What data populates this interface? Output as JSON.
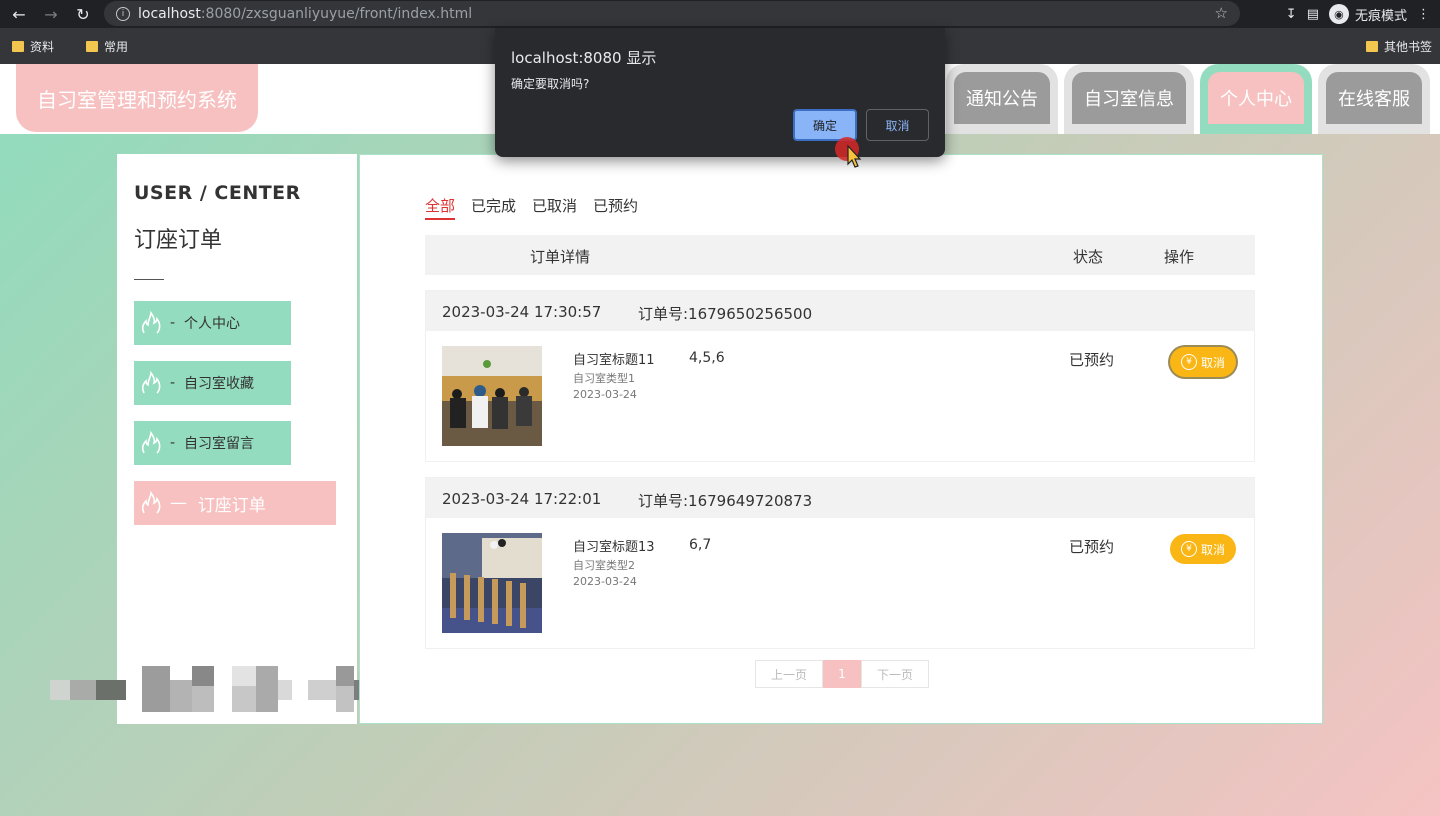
{
  "browser": {
    "url_host": "localhost",
    "url_port_path": ":8080/zxsguanliyuyue/front/index.html",
    "incognito_label": "无痕模式",
    "bookmarks": [
      "资料",
      "常用"
    ],
    "other_bookmarks": "其他书签"
  },
  "site": {
    "logo": "自习室管理和预约系统",
    "nav": [
      {
        "label": "通知公告",
        "active": false
      },
      {
        "label": "自习室信息",
        "active": false
      },
      {
        "label": "个人中心",
        "active": true
      },
      {
        "label": "在线客服",
        "active": false
      }
    ]
  },
  "sidebar": {
    "title": "USER / CENTER",
    "subtitle": "订座订单",
    "items": [
      {
        "prefix": "-",
        "label": "个人中心"
      },
      {
        "prefix": "-",
        "label": "自习室收藏"
      },
      {
        "prefix": "-",
        "label": "自习室留言"
      },
      {
        "prefix": "—",
        "label": "订座订单"
      }
    ]
  },
  "orders": {
    "filters": [
      "全部",
      "已完成",
      "已取消",
      "已预约"
    ],
    "headers": {
      "detail": "订单详情",
      "status": "状态",
      "action": "操作"
    },
    "items": [
      {
        "time": "2023-03-24 17:30:57",
        "order_no": "订单号:1679650256500",
        "title": "自习室标题11",
        "type": "自习室类型1",
        "date": "2023-03-24",
        "seats": "4,5,6",
        "status": "已预约",
        "action": "取消"
      },
      {
        "time": "2023-03-24 17:22:01",
        "order_no": "订单号:1679649720873",
        "title": "自习室标题13",
        "type": "自习室类型2",
        "date": "2023-03-24",
        "seats": "6,7",
        "status": "已预约",
        "action": "取消"
      }
    ],
    "pager": {
      "prev": "上一页",
      "page": "1",
      "next": "下一页"
    }
  },
  "dialog": {
    "title": "localhost:8080 显示",
    "message": "确定要取消吗?",
    "ok": "确定",
    "cancel": "取消"
  },
  "colors": {
    "accent_pink": "#f7c1c1",
    "accent_green": "#93dcbf",
    "button_yellow": "#f9b614"
  }
}
